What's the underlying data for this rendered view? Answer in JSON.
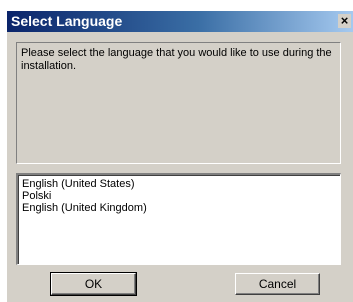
{
  "window": {
    "title": "Select Language",
    "close_glyph": "×"
  },
  "message": {
    "text": "Please select the language that you would like to use during the installation."
  },
  "languages": {
    "items": [
      "English (United States)",
      "Polski",
      "English (United Kingdom)"
    ]
  },
  "buttons": {
    "ok_label": "OK",
    "cancel_label": "Cancel"
  },
  "icons": {
    "close": "close-icon"
  },
  "colors": {
    "titlebar_start": "#0a246a",
    "titlebar_end": "#a6caf0",
    "dialog_face": "#d4d0c8"
  }
}
